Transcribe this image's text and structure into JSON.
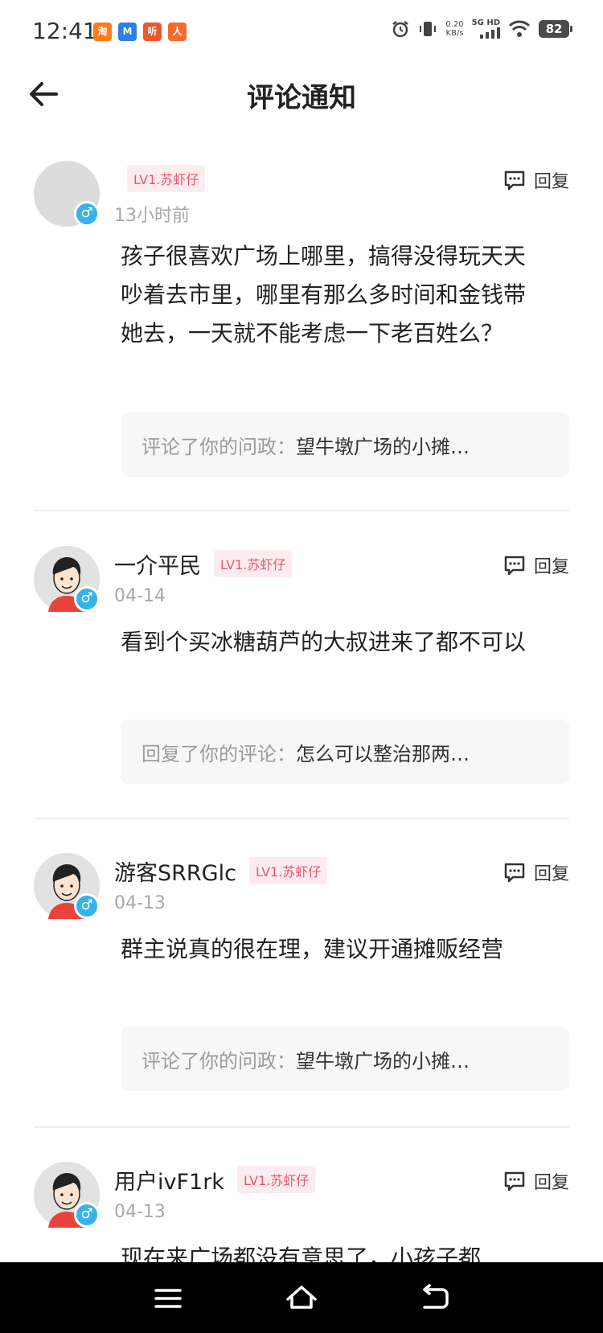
{
  "status": {
    "time": "12:41",
    "apps": [
      {
        "icon": "taobao-app-icon",
        "glyph": "淘",
        "color": "#ff7a1a"
      },
      {
        "icon": "mail-app-icon",
        "glyph": "M",
        "color": "#2f7fe8"
      },
      {
        "icon": "ting-app-icon",
        "glyph": "听",
        "color": "#f0552c"
      },
      {
        "icon": "fitness-app-icon",
        "glyph": "人",
        "color": "#f46b2a"
      }
    ],
    "net_speed": "0.20",
    "net_unit": "KB/s",
    "network": "5G HD",
    "battery": "82"
  },
  "header": {
    "title": "评论通知"
  },
  "comments": [
    {
      "username": "",
      "level": "LV1.苏虾仔",
      "time": "13小时前",
      "reply_label": "回复",
      "content": "孩子很喜欢广场上哪里，搞得没得玩天天吵着去市里，哪里有那么多时间和金钱带她去，一天就不能考虑一下老百姓么？",
      "quote_prefix": "评论了你的问政：",
      "quote_text": "望牛墩广场的小摊…",
      "avatar": "blank"
    },
    {
      "username": "一介平民",
      "level": "LV1.苏虾仔",
      "time": "04-14",
      "reply_label": "回复",
      "content": "看到个买冰糖葫芦的大叔进来了都不可以",
      "quote_prefix": "回复了你的评论：",
      "quote_text": "怎么可以整治那两…",
      "avatar": "cartoon"
    },
    {
      "username": "游客SRRGlc",
      "level": "LV1.苏虾仔",
      "time": "04-13",
      "reply_label": "回复",
      "content": "群主说真的很在理，建议开通摊贩经营",
      "quote_prefix": "评论了你的问政：",
      "quote_text": "望牛墩广场的小摊…",
      "avatar": "cartoon"
    },
    {
      "username": "用户ivF1rk",
      "level": "LV1.苏虾仔",
      "time": "04-13",
      "reply_label": "回复",
      "content": "现在来广场都没有意思了，小孩子都",
      "quote_prefix": "",
      "quote_text": "",
      "avatar": "cartoon"
    }
  ],
  "gender_symbol": "♂",
  "colors": {
    "level_bg": "#fdecef",
    "level_text": "#e7566e",
    "gender_badge": "#36b3e8",
    "nav_bar": "#000000"
  },
  "nav": {
    "icons": [
      "menu-icon",
      "home-icon",
      "back-nav-icon"
    ]
  }
}
